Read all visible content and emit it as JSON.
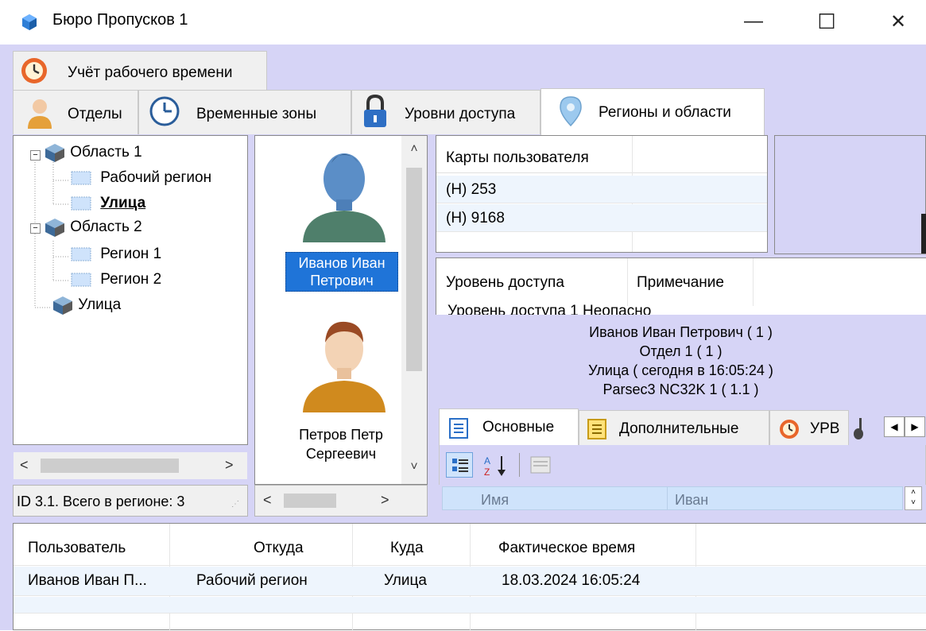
{
  "window": {
    "title": "Бюро Пропусков 1",
    "minimize": "—",
    "maximize": "☐",
    "close": "✕"
  },
  "top_tab": {
    "label": "Учёт рабочего времени"
  },
  "tabs": [
    {
      "label": "Отделы"
    },
    {
      "label": "Временные зоны"
    },
    {
      "label": "Уровни доступа"
    },
    {
      "label": "Регионы и области"
    }
  ],
  "tree": {
    "items": [
      {
        "label": "Область 1"
      },
      {
        "label": "Рабочий регион"
      },
      {
        "label": "Улица"
      },
      {
        "label": "Область 2"
      },
      {
        "label": "Регион 1"
      },
      {
        "label": "Регион 2"
      },
      {
        "label": "Улица"
      }
    ],
    "status": "ID 3.1. Всего в регионе: 3"
  },
  "people": [
    {
      "name_line1": "Иванов Иван",
      "name_line2": "Петрович"
    },
    {
      "name_line1": "Петров Петр",
      "name_line2": "Сергеевич"
    }
  ],
  "cards_table": {
    "header": "Карты пользователя",
    "rows": [
      "(H) 253",
      "(H) 9168"
    ]
  },
  "access_table": {
    "headers": [
      "Уровень доступа",
      "Примечание"
    ],
    "partial_row": "Уровень доступа 1   Неопасно"
  },
  "info": {
    "line1": "Иванов Иван Петрович ( 1 )",
    "line2": "Отдел 1 ( 1 )",
    "line3": "Улица ( сегодня в 16:05:24 )",
    "line4": "Parsec3 NC32K 1 ( 1.1 )"
  },
  "props_tabs": [
    {
      "label": "Основные"
    },
    {
      "label": "Дополнительные"
    },
    {
      "label": "УРВ"
    }
  ],
  "props_grid": {
    "name_label": "Имя",
    "name_value": "Иван"
  },
  "events": {
    "headers": [
      "Пользователь",
      "Откуда",
      "Куда",
      "Фактическое время"
    ],
    "rows": [
      {
        "user": "Иванов Иван П...",
        "from": "Рабочий регион",
        "to": "Улица",
        "time": "18.03.2024 16:05:24"
      }
    ]
  }
}
